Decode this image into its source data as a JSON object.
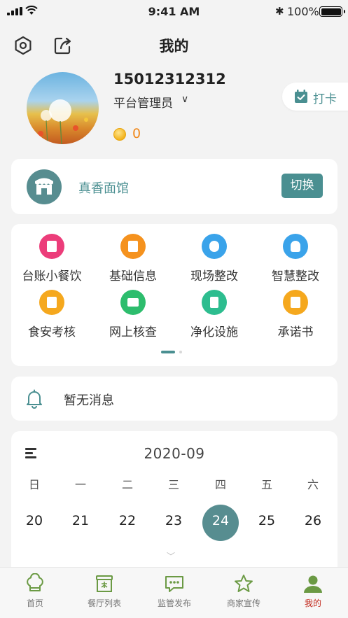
{
  "status_bar": {
    "time": "9:41 AM",
    "battery": "100%",
    "bluetooth_glyph": "✱"
  },
  "header": {
    "title": "我的",
    "left_icons": [
      "settings-hexagon-icon",
      "share-icon"
    ]
  },
  "profile": {
    "phone": "15012312312",
    "role": "平台管理员",
    "role_chevron": "∨",
    "coins": "0",
    "checkin_label": "打卡"
  },
  "store": {
    "name": "真香面馆",
    "switch_label": "切换"
  },
  "functions": [
    {
      "label": "台账小餐饮",
      "color": "#ec3d7a",
      "icon": "clipboard-icon"
    },
    {
      "label": "基础信息",
      "color": "#f5921e",
      "icon": "document-icon"
    },
    {
      "label": "现场整改",
      "color": "#3aa3ea",
      "icon": "cloud-rectify-icon"
    },
    {
      "label": "智慧整改",
      "color": "#3aa3ea",
      "icon": "bulb-rectify-icon"
    },
    {
      "label": "食安考核",
      "color": "#f5a81e",
      "icon": "check-clipboard-icon"
    },
    {
      "label": "网上核查",
      "color": "#2dbd6d",
      "icon": "id-card-icon"
    },
    {
      "label": "净化设施",
      "color": "#2dbd8f",
      "icon": "purifier-icon"
    },
    {
      "label": "承诺书",
      "color": "#f5a81e",
      "icon": "letter-icon"
    }
  ],
  "functions_page": {
    "current": 1,
    "total": 2
  },
  "message": {
    "text": "暂无消息"
  },
  "calendar": {
    "month": "2020-09",
    "weekdays": [
      "日",
      "一",
      "二",
      "三",
      "四",
      "五",
      "六"
    ],
    "days": [
      "20",
      "21",
      "22",
      "23",
      "24",
      "25",
      "26"
    ],
    "selected": "24",
    "expand_glyph": "﹀"
  },
  "tabbar": {
    "items": [
      {
        "label": "首页",
        "icon": "chef-hat-icon",
        "active": false
      },
      {
        "label": "餐厅列表",
        "icon": "restaurant-icon",
        "active": false
      },
      {
        "label": "监管发布",
        "icon": "chat-bubble-icon",
        "active": false
      },
      {
        "label": "商家宣传",
        "icon": "star-icon",
        "active": false
      },
      {
        "label": "我的",
        "icon": "person-icon",
        "active": true
      }
    ]
  },
  "colors": {
    "accent": "#4a8f91",
    "accent_dark": "#578d90",
    "coin": "#f0891c",
    "active_tab": "#c2281c"
  }
}
